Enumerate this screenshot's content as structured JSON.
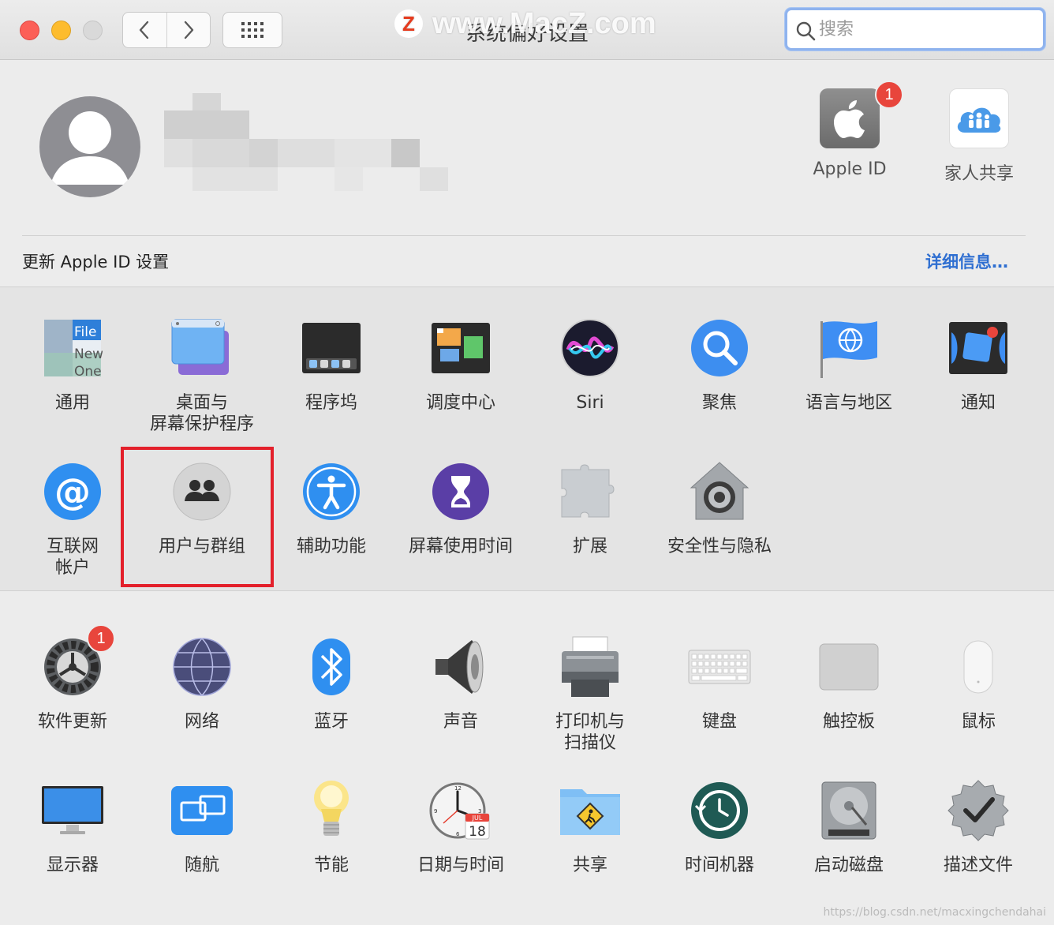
{
  "window": {
    "title": "系统偏好设置",
    "watermark_logo": "Z",
    "watermark_text": "www.MacZ.com"
  },
  "toolbar": {
    "back_icon": "chevron-left-icon",
    "forward_icon": "chevron-right-icon",
    "grid_icon": "grid-icon",
    "search_placeholder": "搜索"
  },
  "account": {
    "avatar_icon": "user-silhouette-icon",
    "tiles": [
      {
        "label": "Apple ID",
        "badge": "1"
      },
      {
        "label": "家人共享"
      }
    ],
    "update_text": "更新 Apple ID 设置",
    "details_link": "详细信息…"
  },
  "sections": {
    "personal": [
      {
        "label": "通用",
        "icon": "general-icon"
      },
      {
        "label": "桌面与\n屏幕保护程序",
        "icon": "desktop-icon"
      },
      {
        "label": "程序坞",
        "icon": "dock-icon"
      },
      {
        "label": "调度中心",
        "icon": "mission-control-icon"
      },
      {
        "label": "Siri",
        "icon": "siri-icon"
      },
      {
        "label": "聚焦",
        "icon": "spotlight-icon"
      },
      {
        "label": "语言与地区",
        "icon": "language-flag-icon"
      },
      {
        "label": "通知",
        "icon": "notifications-icon"
      },
      {
        "label": "互联网\n帐户",
        "icon": "internet-accounts-icon"
      },
      {
        "label": "用户与群组",
        "icon": "users-groups-icon"
      },
      {
        "label": "辅助功能",
        "icon": "accessibility-icon"
      },
      {
        "label": "屏幕使用时间",
        "icon": "screen-time-icon"
      },
      {
        "label": "扩展",
        "icon": "extensions-icon"
      },
      {
        "label": "安全性与隐私",
        "icon": "security-icon"
      }
    ],
    "hardware": [
      {
        "label": "软件更新",
        "icon": "software-update-icon",
        "badge": "1"
      },
      {
        "label": "网络",
        "icon": "network-icon"
      },
      {
        "label": "蓝牙",
        "icon": "bluetooth-icon"
      },
      {
        "label": "声音",
        "icon": "sound-icon"
      },
      {
        "label": "打印机与\n扫描仪",
        "icon": "printer-icon"
      },
      {
        "label": "键盘",
        "icon": "keyboard-icon"
      },
      {
        "label": "触控板",
        "icon": "trackpad-icon"
      },
      {
        "label": "鼠标",
        "icon": "mouse-icon"
      },
      {
        "label": "显示器",
        "icon": "display-icon"
      },
      {
        "label": "随航",
        "icon": "sidecar-icon"
      },
      {
        "label": "节能",
        "icon": "energy-saver-icon"
      },
      {
        "label": "日期与时间",
        "icon": "date-time-icon"
      },
      {
        "label": "共享",
        "icon": "sharing-icon"
      },
      {
        "label": "时间机器",
        "icon": "time-machine-icon"
      },
      {
        "label": "启动磁盘",
        "icon": "startup-disk-icon"
      },
      {
        "label": "描述文件",
        "icon": "profiles-icon"
      }
    ]
  },
  "general_icon_text": {
    "line1": "File",
    "line2": "New",
    "line3": "One"
  },
  "date_icon_text": {
    "month": "JUL",
    "day": "18"
  },
  "footer_url": "https://blog.csdn.net/macxingchendahai",
  "colors": {
    "highlight_border": "#e3202b",
    "link": "#2f6fd1",
    "badge": "#e8453c"
  }
}
